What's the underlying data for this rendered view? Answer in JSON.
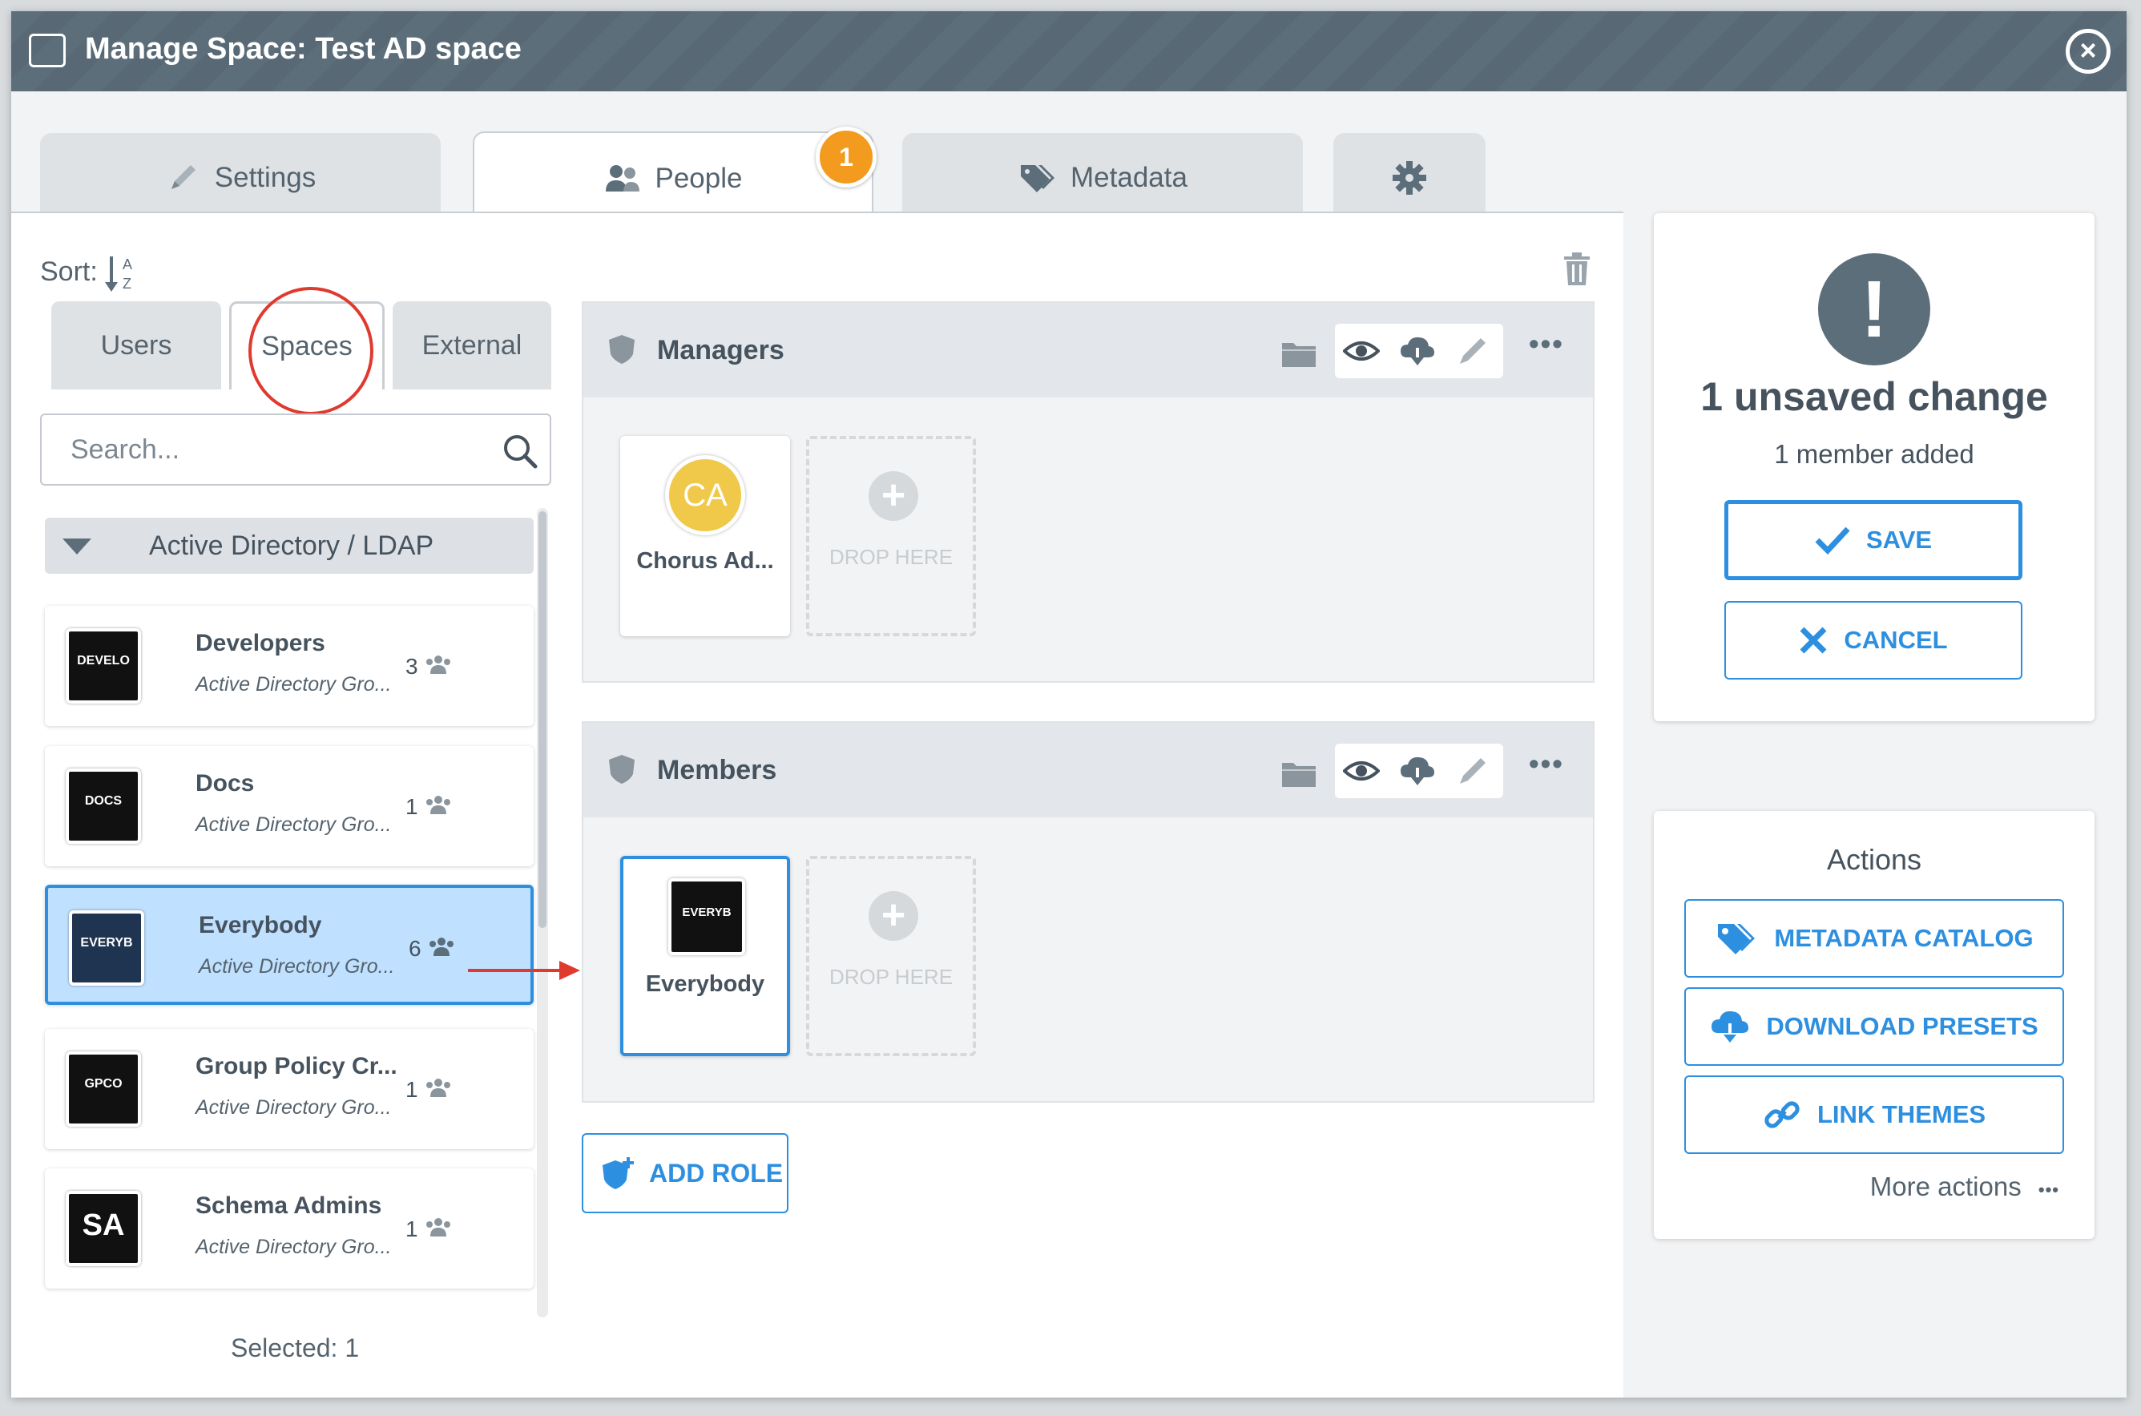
{
  "window": {
    "title": "Manage Space: Test AD space"
  },
  "tabs": {
    "settings": "Settings",
    "people": "People",
    "people_badge": "1",
    "metadata": "Metadata"
  },
  "left": {
    "sort_label": "Sort:",
    "subtabs": {
      "users": "Users",
      "spaces": "Spaces",
      "external": "External"
    },
    "search_placeholder": "Search...",
    "group_header": "Active Directory / LDAP",
    "items": [
      {
        "name": "Developers",
        "sub": "Active Directory Gro...",
        "count": "3",
        "thumb": "DEVELO"
      },
      {
        "name": "Docs",
        "sub": "Active Directory Gro...",
        "count": "1",
        "thumb": "DOCS"
      },
      {
        "name": "Everybody",
        "sub": "Active Directory Gro...",
        "count": "6",
        "thumb": "EVERYB"
      },
      {
        "name": "Group Policy Cr...",
        "sub": "Active Directory Gro...",
        "count": "1",
        "thumb": "GPCO"
      },
      {
        "name": "Schema Admins",
        "sub": "Active Directory Gro...",
        "count": "1",
        "thumb": "SA"
      }
    ],
    "selected_label": "Selected: 1"
  },
  "roles": {
    "managers": {
      "title": "Managers",
      "card_name": "Chorus Ad...",
      "card_initials": "CA",
      "drop_text": "DROP HERE"
    },
    "members": {
      "title": "Members",
      "card_name": "Everybody",
      "card_thumb": "EVERYB",
      "drop_text": "DROP HERE"
    },
    "add_role": "ADD ROLE"
  },
  "status": {
    "icon": "!",
    "title": "1 unsaved change",
    "subtitle": "1 member added",
    "save": "SAVE",
    "cancel": "CANCEL"
  },
  "actions": {
    "title": "Actions",
    "metadata_catalog": "METADATA CATALOG",
    "download_presets": "DOWNLOAD PRESETS",
    "link_themes": "LINK THEMES",
    "more_actions": "More actions"
  },
  "colors": {
    "accent": "#2d8fe0",
    "badge": "#f39b1e",
    "annotation": "#e03a2f",
    "titlebar": "#5d6e7b"
  }
}
